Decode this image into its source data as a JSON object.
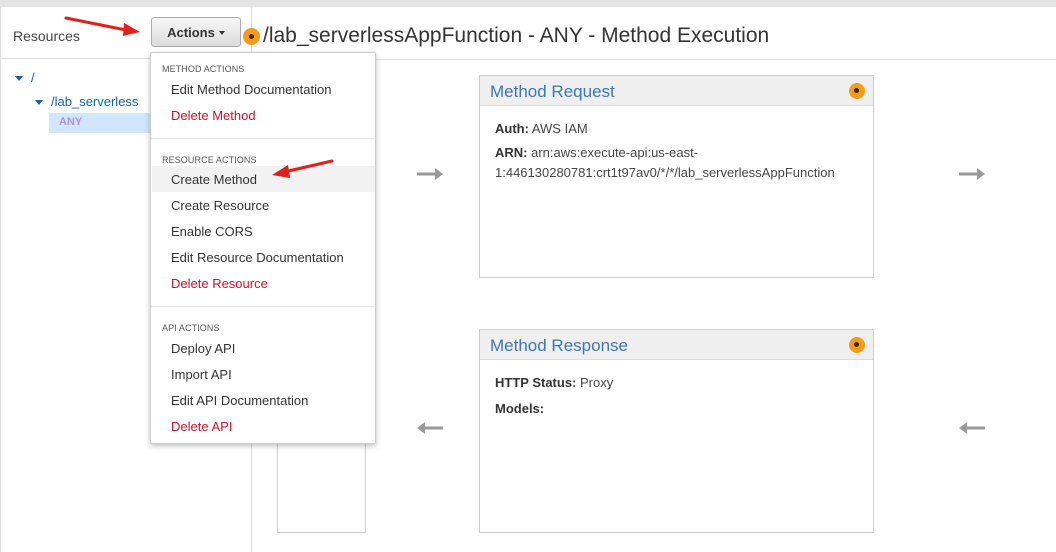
{
  "header": {
    "resources_label": "Resources",
    "actions_button_label": "Actions",
    "page_title": "/lab_serverlessAppFunction - ANY - Method Execution"
  },
  "tree": {
    "root": "/",
    "resource": "/lab_serverless",
    "method": "ANY"
  },
  "menu": {
    "method_actions_label": "METHOD ACTIONS",
    "edit_method_doc": "Edit Method Documentation",
    "delete_method": "Delete Method",
    "resource_actions_label": "RESOURCE ACTIONS",
    "create_method": "Create Method",
    "create_resource": "Create Resource",
    "enable_cors": "Enable CORS",
    "edit_resource_doc": "Edit Resource Documentation",
    "delete_resource": "Delete Resource",
    "api_actions_label": "API ACTIONS",
    "deploy_api": "Deploy API",
    "import_api": "Import API",
    "edit_api_doc": "Edit API Documentation",
    "delete_api": "Delete API"
  },
  "method_request": {
    "title": "Method Request",
    "auth_key": "Auth:",
    "auth_value": "AWS IAM",
    "arn_key": "ARN:",
    "arn_line1": "arn:aws:execute-api:us-east-",
    "arn_line2": "1:446130280781:crt1t97av0/*/*/lab_serverlessAppFunction"
  },
  "method_response": {
    "title": "Method Response",
    "http_status_key": "HTTP Status:",
    "http_status_value": "Proxy",
    "models_key": "Models:"
  },
  "colors": {
    "accent_orange": "#f49c1a",
    "link_blue": "#1a5fa8",
    "card_title_blue": "#3c78b5",
    "danger_red": "#c7162b",
    "annotation_red": "#e0201b"
  }
}
